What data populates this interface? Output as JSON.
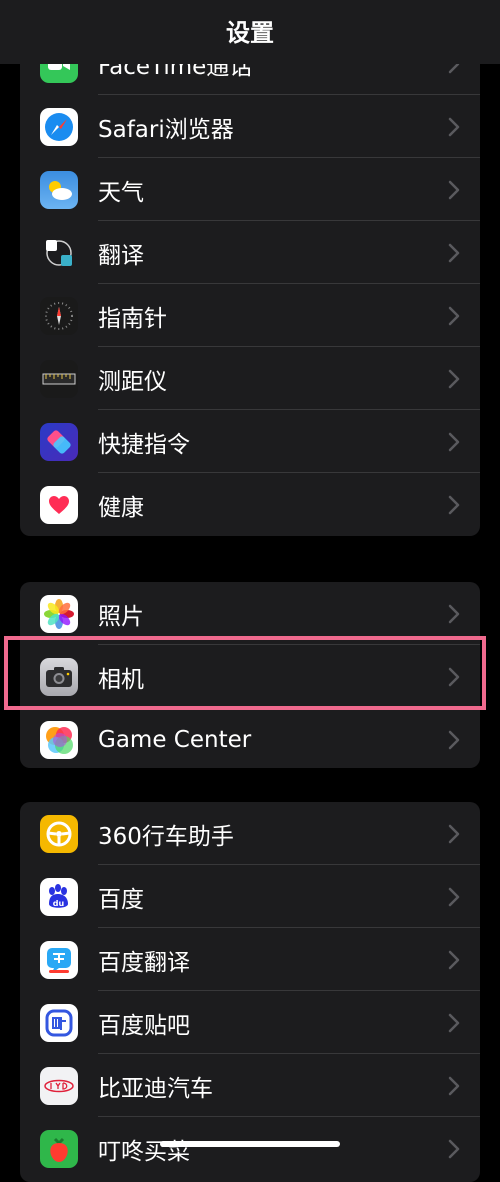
{
  "nav": {
    "title": "设置"
  },
  "groups": [
    {
      "items": [
        {
          "label": "FaceTime通话",
          "icon": "facetime-icon"
        },
        {
          "label": "Safari浏览器",
          "icon": "safari-icon"
        },
        {
          "label": "天气",
          "icon": "weather-icon"
        },
        {
          "label": "翻译",
          "icon": "translate-icon"
        },
        {
          "label": "指南针",
          "icon": "compass-icon"
        },
        {
          "label": "测距仪",
          "icon": "measure-icon"
        },
        {
          "label": "快捷指令",
          "icon": "shortcuts-icon"
        },
        {
          "label": "健康",
          "icon": "health-icon"
        }
      ]
    },
    {
      "items": [
        {
          "label": "照片",
          "icon": "photos-icon"
        },
        {
          "label": "相机",
          "icon": "camera-icon",
          "highlighted": true
        },
        {
          "label": "Game Center",
          "icon": "game-center-icon"
        }
      ]
    },
    {
      "items": [
        {
          "label": "360行车助手",
          "icon": "steering-wheel-icon"
        },
        {
          "label": "百度",
          "icon": "baidu-icon"
        },
        {
          "label": "百度翻译",
          "icon": "baidu-translate-icon"
        },
        {
          "label": "百度贴吧",
          "icon": "tieba-icon"
        },
        {
          "label": "比亚迪汽车",
          "icon": "byd-icon"
        },
        {
          "label": "叮咚买菜",
          "icon": "dingdong-icon"
        }
      ]
    }
  ],
  "colors": {
    "background": "#000000",
    "group_bg": "#1c1c1e",
    "chevron": "#5a5a5e",
    "highlight_border": "#f06a8e"
  }
}
